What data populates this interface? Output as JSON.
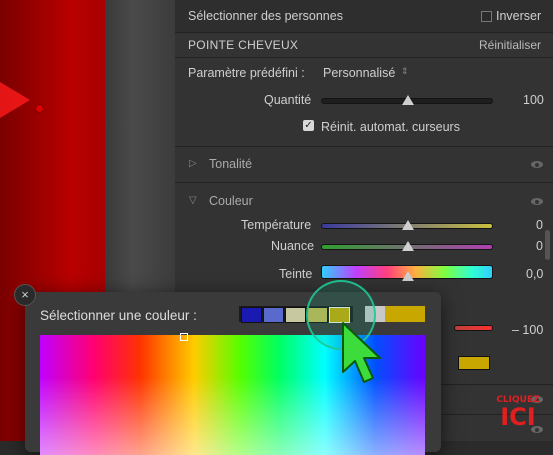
{
  "header": {
    "select_people_label": "Sélectionner des personnes",
    "invert_label": "Inverser"
  },
  "mask": {
    "name": "POINTE CHEVEUX",
    "reset_label": "Réinitialiser",
    "preset_label": "Paramètre prédéfini :",
    "preset_value": "Personnalisé",
    "amount_label": "Quantité",
    "amount_value": "100",
    "amount_level": 1.0,
    "auto_reset_label": "Réinit. automat. curseurs",
    "auto_reset_checked": true
  },
  "sections": {
    "tone_label": "Tonalité",
    "color_label": "Couleur"
  },
  "color": {
    "temp_label": "Température",
    "temp_value": "0",
    "tint_label": "Nuance",
    "tint_value": "0",
    "hue_label": "Teinte",
    "hue_value": "0,0",
    "sat_value": "– 100"
  },
  "picker": {
    "title": "Sélectionner une couleur :",
    "swatches": [
      "#1a1ab0",
      "#5a6acc",
      "#c8c8a0",
      "#c8b850",
      "#c8a800",
      "#c8c8c8",
      "#c8a800"
    ]
  },
  "watermark": {
    "top": "CLIQUEZ",
    "main": "ICI"
  },
  "colors": {
    "accent_ring": "#1ec896",
    "cursor": "#3cdc3c",
    "selected_swatch": "#c8a800"
  }
}
